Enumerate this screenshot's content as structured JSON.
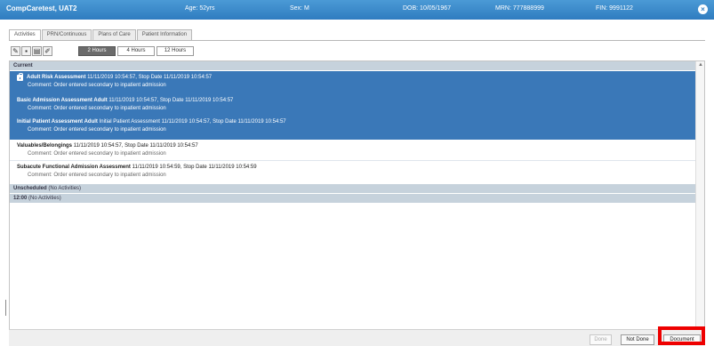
{
  "header": {
    "patient": "CompCaretest, UAT2",
    "age": "Age: 52yrs",
    "sex": "Sex: M",
    "dob": "DOB: 10/05/1967",
    "mrn": "MRN: 777888999",
    "fin": "FIN: 9991122",
    "close_glyph": "×"
  },
  "tabs": [
    {
      "label": "Activities",
      "active": true
    },
    {
      "label": "PRN/Continuous"
    },
    {
      "label": "Plans of Care"
    },
    {
      "label": "Patient Information"
    }
  ],
  "toolbar": {
    "icons": [
      {
        "name": "pen-icon",
        "glyph": "✎"
      },
      {
        "name": "document-icon",
        "glyph": "▪"
      },
      {
        "name": "clipboard-icon",
        "glyph": "▤"
      },
      {
        "name": "edit-icon",
        "glyph": "✐"
      }
    ],
    "hours": [
      {
        "label": "2 Hours",
        "selected": true
      },
      {
        "label": "4 Hours"
      },
      {
        "label": "12 Hours"
      }
    ]
  },
  "sections": {
    "current": "Current",
    "unscheduled": "Unscheduled",
    "unscheduled_sub": "(No Activities)",
    "time": "12:00",
    "time_sub": "(No Activities)"
  },
  "activities": [
    {
      "name": "Adult Risk Assessment",
      "detail": "11/11/2019 10:54:57, Stop Date 11/11/2019 10:54:57",
      "comment": "Comment: Order entered secondary to inpatient admission"
    },
    {
      "name": "Basic Admission Assessment Adult",
      "detail": "11/11/2019 10:54:57, Stop Date 11/11/2019 10:54:57",
      "comment": "Comment: Order entered secondary to inpatient admission"
    },
    {
      "name": "Initial Patient Assessment Adult",
      "detail": "Initial Patient Assessment 11/11/2019 10:54:57, Stop Date 11/11/2019 10:54:57",
      "comment": "Comment: Order entered secondary to inpatient admission"
    },
    {
      "name": "Valuables/Belongings",
      "detail": "11/11/2019 10:54:57, Stop Date 11/11/2019 10:54:57",
      "comment": "Comment: Order entered secondary to inpatient admission"
    },
    {
      "name": "Subacute Functional Admission Assessment",
      "detail": "11/11/2019 10:54:59, Stop Date 11/11/2019 10:54:59",
      "comment": "Comment: Order entered secondary to inpatient admission"
    }
  ],
  "footer": {
    "done": "Done",
    "not_done": "Not Done",
    "document": "Document"
  },
  "colors": {
    "titlebar": "#2f7cc0",
    "selection": "#3a78b8",
    "highlight": "#ee0000"
  }
}
